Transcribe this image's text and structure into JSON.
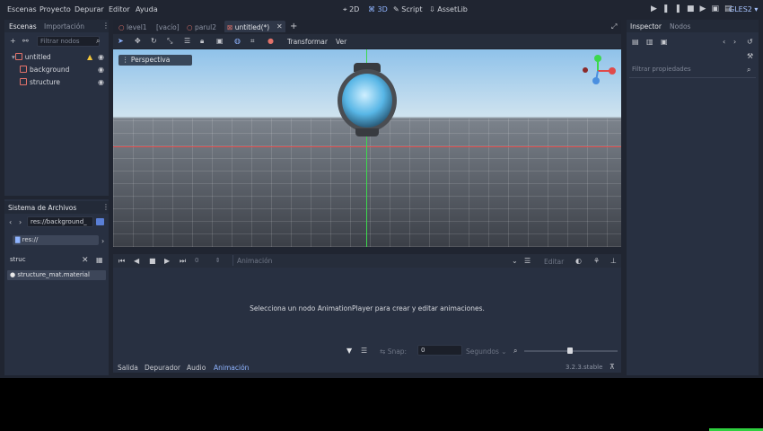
{
  "menu": [
    "Escenas",
    "Proyecto",
    "Depurar",
    "Editor",
    "Ayuda"
  ],
  "modes": [
    {
      "label": "2D",
      "icon": "2d-icon",
      "active": false
    },
    {
      "label": "3D",
      "icon": "3d-icon",
      "active": true
    },
    {
      "label": "Script",
      "icon": "script-icon",
      "active": false
    },
    {
      "label": "AssetLib",
      "icon": "assetlib-icon",
      "active": false
    }
  ],
  "renderer": "GLES2",
  "scene_dock": {
    "tabs": [
      "Escenas",
      "Importación"
    ],
    "filter_placeholder": "Filtrar nodos",
    "nodes": [
      "untitled",
      "background",
      "structure"
    ]
  },
  "filesystem_dock": {
    "title": "Sistema de Archivos",
    "path": "res://background_",
    "root": "res://",
    "search_value": "struc",
    "results": [
      "structure_mat.material"
    ]
  },
  "editor_tabs": [
    "level1",
    "[vacío]",
    "parul2",
    "untitled(*)"
  ],
  "toolbar": {
    "transform": "Transformar",
    "view": "Ver"
  },
  "viewport": {
    "perspective_label": "Perspectiva"
  },
  "inspector": {
    "tabs": [
      "Inspector",
      "Nodos"
    ],
    "filter_placeholder": "Filtrar propiedades"
  },
  "animation": {
    "frame_value": "0",
    "name_placeholder": "Animación",
    "edit_label": "Editar",
    "message": "Selecciona un nodo AnimationPlayer para crear y editar animaciones.",
    "snap_label": "Snap:",
    "snap_value": "0",
    "unit": "Segundos"
  },
  "bottom_tabs": [
    "Salida",
    "Depurador",
    "Audio",
    "Animación"
  ],
  "version": "3.2.3.stable",
  "colors": {
    "accent": "#8fb4ff",
    "warning": "#f3c63a",
    "x_axis": "#e04a4a",
    "y_axis": "#3cd84d"
  }
}
